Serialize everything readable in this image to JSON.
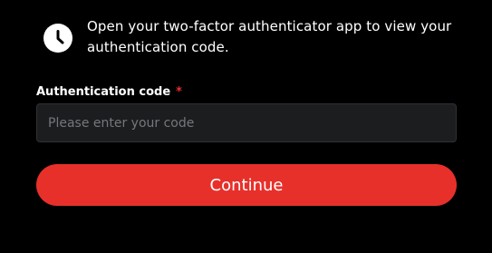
{
  "info": {
    "icon": "clock-icon",
    "message": "Open your two-factor authenticator app to view your authentication code."
  },
  "form": {
    "label": "Authentication code",
    "required_mark": "*",
    "input": {
      "value": "",
      "placeholder": "Please enter your code"
    },
    "submit_label": "Continue"
  },
  "colors": {
    "background": "#000000",
    "accent": "#e8302a",
    "input_background": "#1c1d1f",
    "text": "#ffffff"
  }
}
